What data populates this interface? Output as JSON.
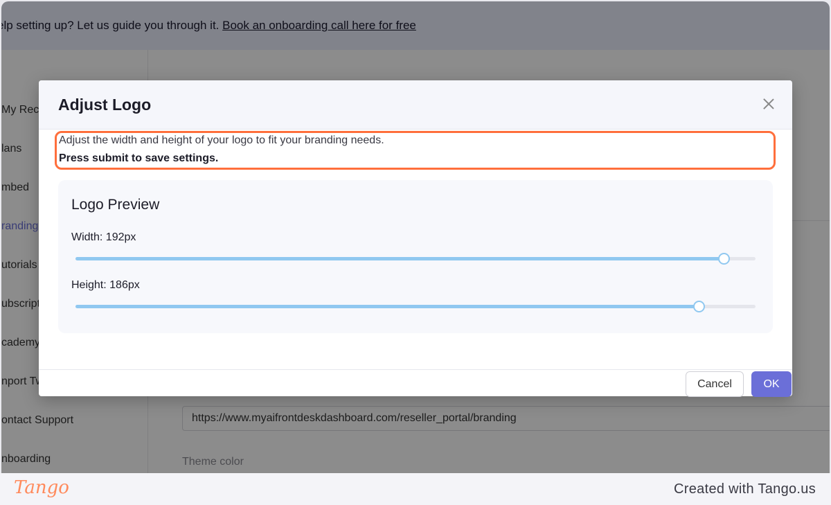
{
  "banner": {
    "text": "elp setting up? Let us guide you through it. ",
    "link": "Book an onboarding call here for free"
  },
  "sidebar": {
    "items": [
      {
        "label": "My Recep",
        "active": false
      },
      {
        "label": "lans",
        "active": false
      },
      {
        "label": "mbed",
        "active": false
      },
      {
        "label": "randing",
        "active": true
      },
      {
        "label": "utorials",
        "active": false
      },
      {
        "label": "ubscript",
        "active": false
      },
      {
        "label": "cademy",
        "active": false
      },
      {
        "label": "nport Tw",
        "active": false
      },
      {
        "label": "ontact Support",
        "active": false
      },
      {
        "label": "nboarding",
        "active": false
      }
    ]
  },
  "content": {
    "url_value": "https://www.myaifrontdeskdashboard.com/reseller_portal/branding",
    "theme_label": "Theme color"
  },
  "modal": {
    "title": "Adjust Logo",
    "description": "Adjust the width and height of your logo to fit your branding needs.",
    "instruction": "Press submit to save settings.",
    "preview_title": "Logo Preview",
    "width_label": "Width: 192px",
    "height_label": "Height: 186px",
    "width_fraction": 0.953,
    "height_fraction": 0.917,
    "cancel_label": "Cancel",
    "ok_label": "OK"
  },
  "colors": {
    "accent": "#6b6fd8",
    "slider": "#90c8f0",
    "highlight": "#ff6f3c"
  },
  "footer": {
    "logo": "Tango",
    "credit": "Created with Tango.us"
  }
}
